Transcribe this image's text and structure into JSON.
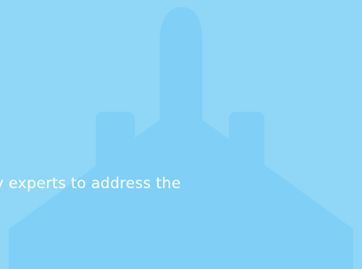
{
  "banner": {
    "background_color": "#8fd6f7",
    "icon": "airplane-icon",
    "icon_color": "#7fcff7",
    "caption": "y experts to address the",
    "caption_color": "#ffffff"
  }
}
